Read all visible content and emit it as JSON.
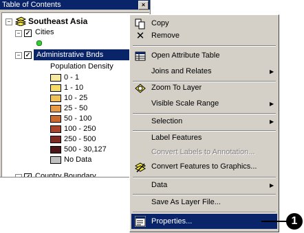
{
  "toc": {
    "title": "Table of Contents",
    "close_glyph": "×",
    "data_frame": "Southeast Asia",
    "layers": [
      {
        "name": "Cities",
        "checked": true
      },
      {
        "name": "Administrative Bnds",
        "checked": true,
        "selected": true
      },
      {
        "name": "Country Boundary",
        "checked": true
      }
    ],
    "legend_heading": "Population Density",
    "legend": [
      {
        "label": "0 - 1",
        "color": "#f5e9a0"
      },
      {
        "label": "1 - 10",
        "color": "#f4dc6a"
      },
      {
        "label": "10 - 25",
        "color": "#f0c05a"
      },
      {
        "label": "25 - 50",
        "color": "#e59b45"
      },
      {
        "label": "50 - 100",
        "color": "#c96a2e"
      },
      {
        "label": "100 - 250",
        "color": "#a8452a"
      },
      {
        "label": "250 - 500",
        "color": "#7e2a22"
      },
      {
        "label": "500 - 30,127",
        "color": "#4c1517"
      },
      {
        "label": "No Data",
        "color": "#c0c0c0"
      }
    ],
    "city_symbol_color": "#33cc33"
  },
  "menu": {
    "items": [
      {
        "label": "Copy",
        "icon": "copy-icon"
      },
      {
        "label": "Remove",
        "icon": "remove-icon"
      },
      {
        "label": "Open Attribute Table",
        "icon": "table-icon"
      },
      {
        "label": "Joins and Relates",
        "submenu": true
      },
      {
        "label": "Zoom To Layer",
        "icon": "zoom-to-layer-icon"
      },
      {
        "label": "Visible Scale Range",
        "submenu": true
      },
      {
        "label": "Selection",
        "submenu": true
      },
      {
        "label": "Label Features"
      },
      {
        "label": "Convert Labels to Annotation...",
        "disabled": true
      },
      {
        "label": "Convert Features to Graphics...",
        "icon": "convert-graphics-icon"
      },
      {
        "label": "Data",
        "submenu": true
      },
      {
        "label": "Save As Layer File..."
      },
      {
        "label": "Properties...",
        "icon": "properties-icon",
        "selected": true
      }
    ]
  },
  "callout": {
    "number": "1"
  },
  "colors": {
    "selection": "#0a246a",
    "face": "#d4d0c8"
  }
}
